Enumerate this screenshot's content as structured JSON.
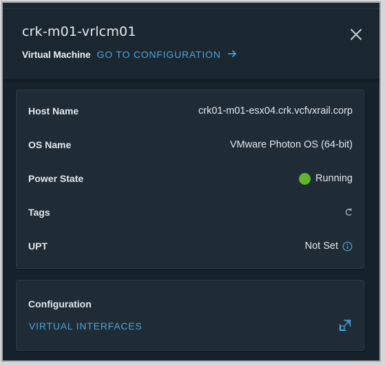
{
  "panel": {
    "title": "crk-m01-vrlcm01",
    "type_label": "Virtual Machine",
    "goto_label": "GO TO CONFIGURATION",
    "close_icon": "close-icon",
    "arrow_icon": "arrow-right-icon"
  },
  "details": {
    "rows": [
      {
        "label": "Host Name",
        "value": "crk01-m01-esx04.crk.vcfvxrail.corp"
      },
      {
        "label": "OS Name",
        "value": "VMware Photon OS (64-bit)"
      },
      {
        "label": "Power State",
        "value": "Running",
        "status_color": "#5fb628"
      },
      {
        "label": "Tags",
        "value_icon": "refresh-icon"
      },
      {
        "label": "UPT",
        "value": "Not Set",
        "value_icon": "info-icon"
      }
    ]
  },
  "configuration": {
    "title": "Configuration",
    "link_label": "VIRTUAL INTERFACES",
    "link_icon": "open-in-panel-icon"
  },
  "colors": {
    "background": "#1b2730",
    "card": "#1f2c36",
    "link": "#4fa3d8",
    "running": "#5fb628"
  }
}
